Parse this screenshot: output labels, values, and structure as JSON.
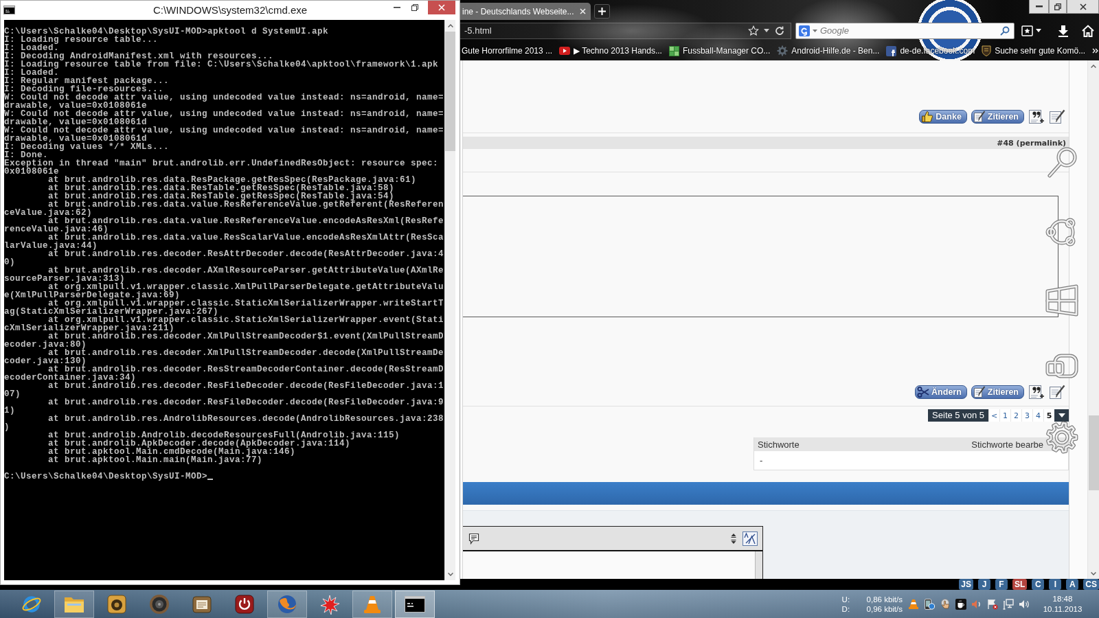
{
  "cmd_window": {
    "title": "C:\\WINDOWS\\system32\\cmd.exe",
    "lines": [
      "C:\\Users\\Schalke04\\Desktop\\SysUI-MOD>apktool d SystemUI.apk",
      "I: Loading resource table...",
      "I: Loaded.",
      "I: Decoding AndroidManifest.xml with resources...",
      "I: Loading resource table from file: C:\\Users\\Schalke04\\apktool\\framework\\1.apk",
      "I: Loaded.",
      "I: Regular manifest package...",
      "I: Decoding file-resources...",
      "W: Could not decode attr value, using undecoded value instead: ns=android, name=",
      "drawable, value=0x0108061e",
      "W: Could not decode attr value, using undecoded value instead: ns=android, name=",
      "drawable, value=0x0108061d",
      "W: Could not decode attr value, using undecoded value instead: ns=android, name=",
      "drawable, value=0x0108061d",
      "I: Decoding values */* XMLs...",
      "I: Done.",
      "Exception in thread \"main\" brut.androlib.err.UndefinedResObject: resource spec:",
      "0x0108061e",
      "        at brut.androlib.res.data.ResPackage.getResSpec(ResPackage.java:61)",
      "        at brut.androlib.res.data.ResTable.getResSpec(ResTable.java:58)",
      "        at brut.androlib.res.data.ResTable.getResSpec(ResTable.java:54)",
      "        at brut.androlib.res.data.value.ResReferenceValue.getReferent(ResReferen",
      "ceValue.java:62)",
      "        at brut.androlib.res.data.value.ResReferenceValue.encodeAsResXml(ResRefe",
      "renceValue.java:46)",
      "        at brut.androlib.res.data.value.ResScalarValue.encodeAsResXmlAttr(ResSca",
      "larValue.java:44)",
      "        at brut.androlib.res.decoder.ResAttrDecoder.decode(ResAttrDecoder.java:4",
      "0)",
      "        at brut.androlib.res.decoder.AXmlResourceParser.getAttributeValue(AXmlRe",
      "sourceParser.java:313)",
      "        at org.xmlpull.v1.wrapper.classic.XmlPullParserDelegate.getAttributeValu",
      "e(XmlPullParserDelegate.java:69)",
      "        at org.xmlpull.v1.wrapper.classic.StaticXmlSerializerWrapper.writeStartT",
      "ag(StaticXmlSerializerWrapper.java:267)",
      "        at org.xmlpull.v1.wrapper.classic.StaticXmlSerializerWrapper.event(Stati",
      "cXmlSerializerWrapper.java:211)",
      "        at brut.androlib.res.decoder.XmlPullStreamDecoder$1.event(XmlPullStreamD",
      "ecoder.java:80)",
      "        at brut.androlib.res.decoder.XmlPullStreamDecoder.decode(XmlPullStreamDe",
      "coder.java:130)",
      "        at brut.androlib.res.decoder.ResStreamDecoderContainer.decode(ResStreamD",
      "ecoderContainer.java:34)",
      "        at brut.androlib.res.decoder.ResFileDecoder.decode(ResFileDecoder.java:1",
      "07)",
      "        at brut.androlib.res.decoder.ResFileDecoder.decode(ResFileDecoder.java:9",
      "1)",
      "        at brut.androlib.res.AndrolibResources.decode(AndrolibResources.java:238",
      ")",
      "        at brut.androlib.Androlib.decodeResourcesFull(Androlib.java:115)",
      "        at brut.androlib.ApkDecoder.decode(ApkDecoder.java:114)",
      "        at brut.apktool.Main.cmdDecode(Main.java:146)",
      "        at brut.apktool.Main.main(Main.java:77)"
    ],
    "prompt": "C:\\Users\\Schalke04\\Desktop\\SysUI-MOD>"
  },
  "browser": {
    "tabs": [
      {
        "label": "ine - Deutschlands Webseite...",
        "selected": true
      }
    ],
    "address": "-5.html",
    "search": {
      "placeholder": "Google"
    },
    "bookmarks": [
      {
        "kind": "plain",
        "label": "Gute Horrorfilme 2013 ..."
      },
      {
        "kind": "video",
        "label": "▶ Techno 2013 Hands..."
      },
      {
        "kind": "puzzle",
        "label": "Fussball-Manager CO..."
      },
      {
        "kind": "gear",
        "label": "Android-Hilfe.de - Ben..."
      },
      {
        "kind": "social",
        "label": "de-de.facebook.com"
      },
      {
        "kind": "crest",
        "label": "Suche sehr gute Komö..."
      }
    ]
  },
  "page": {
    "top_actions": [
      {
        "kind": "thanks",
        "label": "Danke"
      },
      {
        "kind": "quote",
        "label": "Zitieren"
      }
    ],
    "post_label": "#48 (permalink)",
    "bottom_actions": [
      {
        "kind": "edit",
        "label": "Ändern"
      },
      {
        "kind": "quote",
        "label": "Zitieren"
      }
    ],
    "pagination": {
      "label": "Seite 5 von 5",
      "prev": "<",
      "pages": [
        {
          "label": "1",
          "selected": false
        },
        {
          "label": "2",
          "selected": false
        },
        {
          "label": "3",
          "selected": false
        },
        {
          "label": "4",
          "selected": false
        },
        {
          "label": "5",
          "selected": true
        }
      ]
    },
    "tags": {
      "title": "Stichworte",
      "edit_link": "Stichworte bearbe",
      "value": "-"
    }
  },
  "addon_badges": [
    {
      "label": "JS",
      "color": "#3b6896"
    },
    {
      "label": "J",
      "color": "#3b6896"
    },
    {
      "label": "F",
      "color": "#3b6896"
    },
    {
      "label": "SL",
      "color": "#b4453f"
    },
    {
      "label": "C",
      "color": "#3b6896"
    },
    {
      "label": "I",
      "color": "#3b6896"
    },
    {
      "label": "A",
      "color": "#3b6896"
    },
    {
      "label": "CS",
      "color": "#3b6896"
    }
  ],
  "taskbar": {
    "apps": [
      {
        "kind": "orbit",
        "running": false,
        "selected": false
      },
      {
        "kind": "folder",
        "running": true,
        "selected": false
      },
      {
        "kind": "speaker_box",
        "running": false,
        "selected": false
      },
      {
        "kind": "speaker",
        "running": false,
        "selected": false
      },
      {
        "kind": "document",
        "running": false,
        "selected": false
      },
      {
        "kind": "power",
        "running": false,
        "selected": false
      },
      {
        "kind": "globe",
        "running": true,
        "selected": false
      },
      {
        "kind": "splat",
        "running": false,
        "selected": false
      },
      {
        "kind": "cone",
        "running": true,
        "selected": false
      },
      {
        "kind": "terminal",
        "running": true,
        "selected": true
      }
    ],
    "network": {
      "up_label": "U:",
      "up_rate": "0,86 kbit/s",
      "down_label": "D:",
      "down_rate": "0,96 kbit/s"
    },
    "time": "18:48",
    "date": "10.11.2013"
  }
}
